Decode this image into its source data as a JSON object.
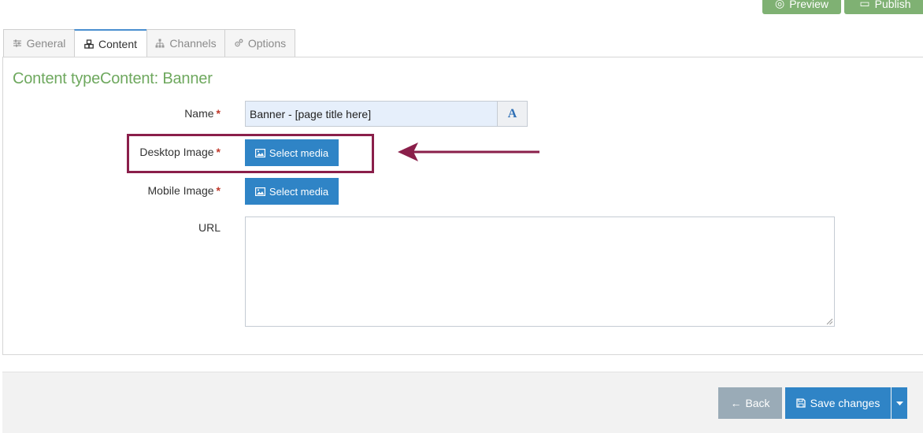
{
  "top_actions": {
    "preview_label": "Preview",
    "publish_label": "Publish"
  },
  "tabs": [
    {
      "label": "General",
      "icon": "sliders-icon",
      "active": false
    },
    {
      "label": "Content",
      "icon": "cubes-icon",
      "active": true
    },
    {
      "label": "Channels",
      "icon": "sitemap-icon",
      "active": false
    },
    {
      "label": "Options",
      "icon": "gears-icon",
      "active": false
    }
  ],
  "page_title": "Content typeContent: Banner",
  "form": {
    "name": {
      "label": "Name",
      "required_mark": "*",
      "value": "Banner - [page title here]",
      "button_glyph": "A"
    },
    "desktop_image": {
      "label": "Desktop Image",
      "required_mark": "*",
      "button_label": "Select media"
    },
    "mobile_image": {
      "label": "Mobile Image",
      "required_mark": "*",
      "button_label": "Select media"
    },
    "url": {
      "label": "URL",
      "value": ""
    }
  },
  "footer": {
    "back_label": "Back",
    "save_label": "Save changes"
  },
  "colors": {
    "primary": "#2f84c6",
    "accent_green": "#6ea85e",
    "annotation": "#8a1f4a",
    "back_button": "#9aabb7"
  }
}
